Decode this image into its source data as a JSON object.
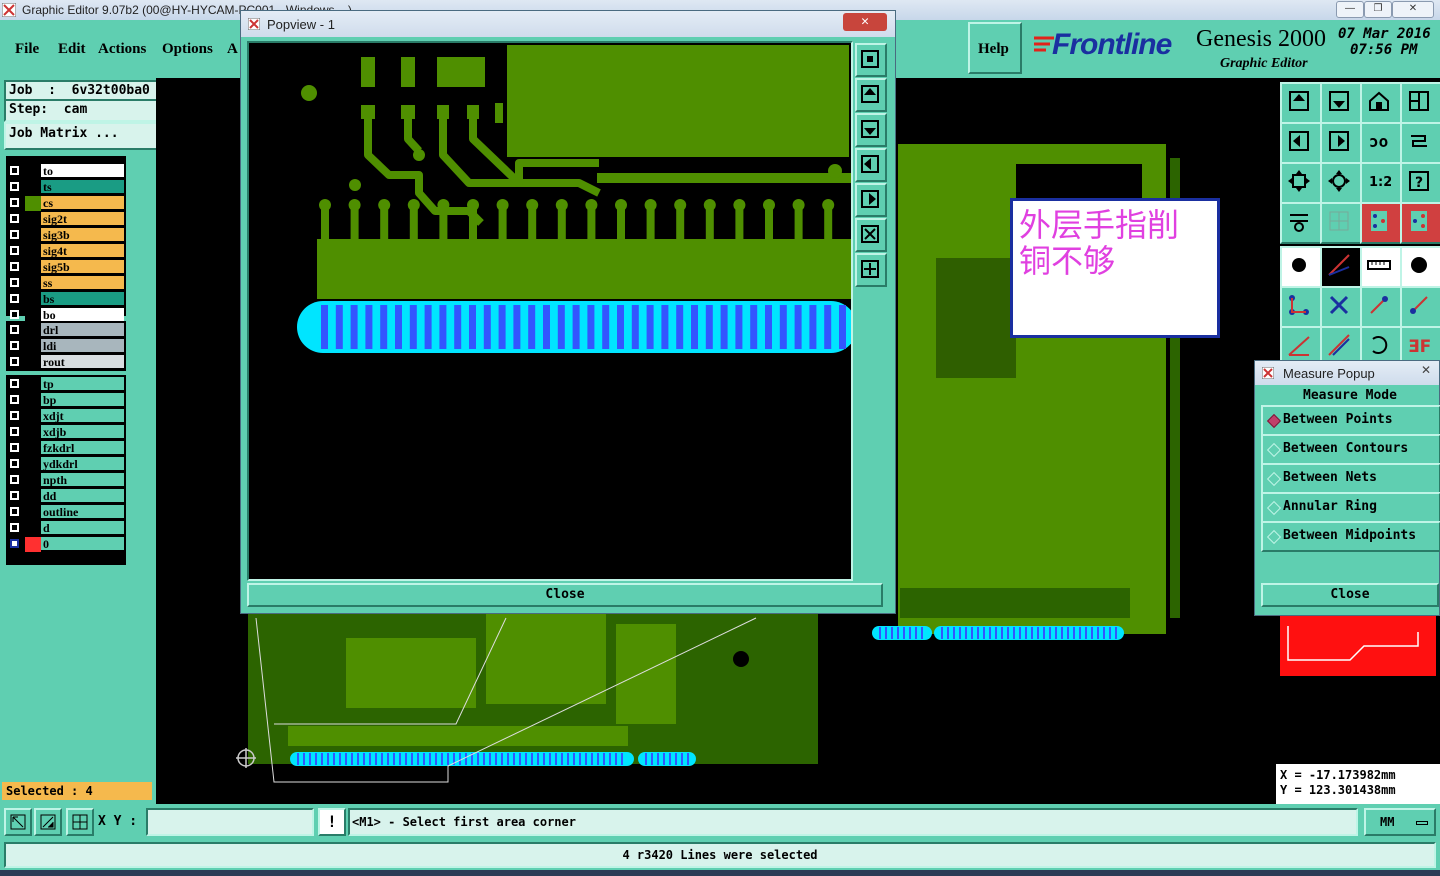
{
  "window": {
    "title": "Graphic Editor 9.07b2 (00@HY-HYCAM-PC001 - Windows ...)",
    "minimize_glyph": "—",
    "restore_glyph": "❐",
    "close_glyph": "✕"
  },
  "menu": {
    "items": [
      "File",
      "Edit",
      "Actions",
      "Options",
      "A"
    ],
    "help": "Help"
  },
  "brand": {
    "logo": "Frontline",
    "product": "Genesis 2000",
    "subtitle": "Graphic Editor",
    "date": "07 Mar 2016",
    "time": "07:56 PM"
  },
  "job": {
    "job_label": "Job  :  6v32t00ba0",
    "step_label": "Step:  cam",
    "matrix_button": "Job Matrix ..."
  },
  "layers": {
    "group1": [
      {
        "name": "to",
        "color": "#ffffff"
      },
      {
        "name": "ts",
        "color": "#1a9c84"
      },
      {
        "name": "cs",
        "color": "#f5b94d"
      },
      {
        "name": "sig2t",
        "color": "#f5b94d"
      },
      {
        "name": "sig3b",
        "color": "#f5b94d"
      },
      {
        "name": "sig4t",
        "color": "#f5b94d"
      },
      {
        "name": "sig5b",
        "color": "#f5b94d"
      },
      {
        "name": "ss",
        "color": "#f5b94d"
      },
      {
        "name": "bs",
        "color": "#1a9c84"
      },
      {
        "name": "bo",
        "color": "#ffffff"
      }
    ],
    "group2": [
      {
        "name": "drl",
        "color": "#a8b6bd"
      },
      {
        "name": "ldi",
        "color": "#a8b6bd"
      },
      {
        "name": "rout",
        "color": "#d8dde0"
      }
    ],
    "group3": [
      {
        "name": "tp",
        "color": "#5fcfb1"
      },
      {
        "name": "bp",
        "color": "#5fcfb1"
      },
      {
        "name": "xdjt",
        "color": "#5fcfb1"
      },
      {
        "name": "xdjb",
        "color": "#5fcfb1"
      },
      {
        "name": "fzkdrl",
        "color": "#5fcfb1"
      },
      {
        "name": "ydkdrl",
        "color": "#5fcfb1"
      },
      {
        "name": "npth",
        "color": "#5fcfb1"
      },
      {
        "name": "dd",
        "color": "#5fcfb1"
      },
      {
        "name": "outline",
        "color": "#5fcfb1"
      },
      {
        "name": "d",
        "color": "#5fcfb1"
      },
      {
        "name": "0",
        "color": "#5fcfb1"
      }
    ]
  },
  "selected": "Selected : 4",
  "popview": {
    "title": "Popview - 1",
    "close_button": "Close",
    "close_glyph": "✕"
  },
  "annotation": {
    "line1": "外层手指削",
    "line2": "铜不够"
  },
  "measure": {
    "title": "Measure Popup",
    "header": "Measure Mode",
    "options": [
      "Between Points",
      "Between Contours",
      "Between Nets",
      "Annular Ring",
      "Between Midpoints"
    ],
    "selected_index": 0,
    "close_button": "Close",
    "close_glyph": "✕"
  },
  "coords": {
    "x": "X  =  -17.173982mm",
    "y": "Y  =  123.301438mm"
  },
  "command": {
    "xy_label": "X Y :",
    "xy_value": "",
    "prompt": "<M1> - Select first area corner",
    "units": "MM",
    "alert_glyph": "!"
  },
  "status": "4 r3420 Lines were selected",
  "colors": {
    "panel": "#5fcfb1",
    "copper": "#4f8f00",
    "finger": "#3355ff",
    "finger_outline": "#00e5ff",
    "annotation": "#e040e0"
  }
}
